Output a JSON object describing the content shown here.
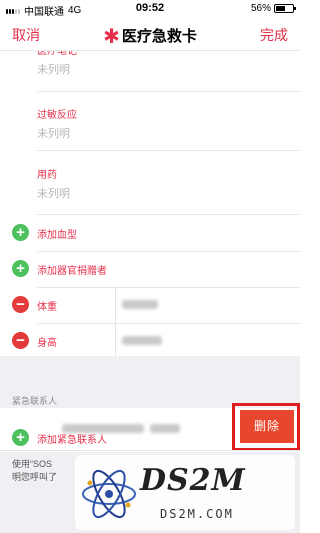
{
  "status_bar": {
    "carrier": "中国联通",
    "network": "4G",
    "time": "09:52",
    "battery": "56%",
    "battery_level": 0.56
  },
  "nav": {
    "cancel": "取消",
    "title": "医疗急救卡",
    "done": "完成",
    "accent": "#e5304b"
  },
  "fields": [
    {
      "label": "医疗笔记",
      "value": "未列明"
    },
    {
      "label": "过敏反应",
      "value": "未列明"
    },
    {
      "label": "用药",
      "value": "未列明"
    }
  ],
  "add_rows": {
    "blood_type": "添加血型",
    "organ_donor": "添加器官捐赠者"
  },
  "measure_rows": {
    "weight": "体重",
    "height": "身高"
  },
  "emergency": {
    "header": "紧急联系人",
    "delete": "删除",
    "add_contact": "添加紧急联系人"
  },
  "footer": {
    "text_line1": "使用“SOS",
    "text_line2": "明您呼叫了"
  },
  "watermark": {
    "title": "DS2M",
    "subtitle": "DS2M.COM"
  },
  "icons": {
    "add": "plus-circle-icon",
    "remove": "minus-circle-icon",
    "medical": "asterisk-icon"
  }
}
